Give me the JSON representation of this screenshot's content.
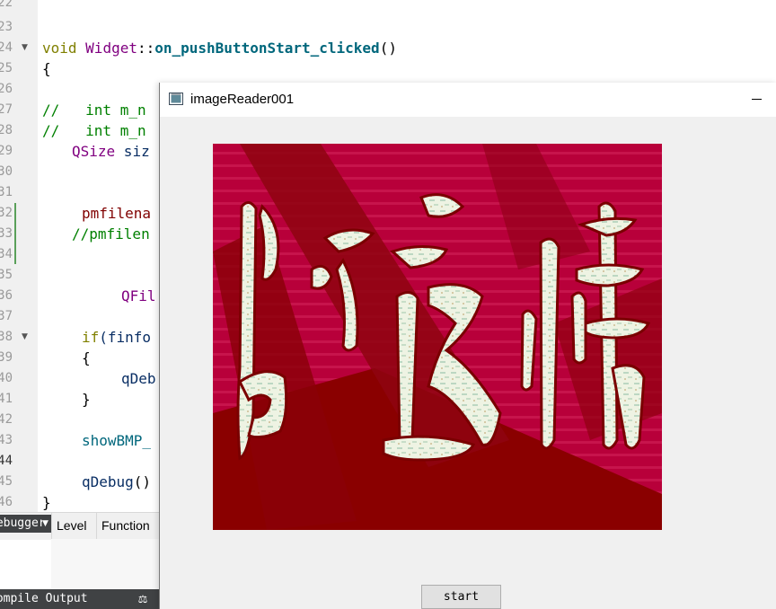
{
  "editor": {
    "line_numbers": [
      "22",
      "23",
      "24",
      "25",
      "26",
      "27",
      "28",
      "29",
      "30",
      "31",
      "32",
      "33",
      "34",
      "35",
      "36",
      "37",
      "38",
      "39",
      "40",
      "41",
      "42",
      "43",
      "44",
      "45",
      "46"
    ],
    "lines": {
      "l24_kw": "void",
      "l24_class": "Widget",
      "l24_sep": "::",
      "l24_fn": "on_pushButtonStart_clicked",
      "l24_paren": "()",
      "l25": "{",
      "l27_comment": "//   int m_n",
      "l28_comment": "//   int m_n",
      "l29_type": "QSize",
      "l29_rest": " siz",
      "l32": "pmfilena",
      "l33_comment": "//pmfilen",
      "l36": "QFil",
      "l38_kw": "if",
      "l38_rest": "(finfo",
      "l39": "{",
      "l40": "qDeb",
      "l41": "}",
      "l43": "showBMP_",
      "l45_fn": "qDebug",
      "l45_rest": "()",
      "l46": "}"
    }
  },
  "output_pane": {
    "debugger_combo": "Debugger",
    "columns": [
      "Level",
      "Function"
    ],
    "status_tab": "Compile Output"
  },
  "window": {
    "title": "imageReader001",
    "start_button": "start",
    "image_alt": "红色背景上的白色毛笔字（上方图片内容）"
  },
  "colors": {
    "image_bg": "#b8003a",
    "brush_stroke": "#e9f0de",
    "shadow_red": "#8a0000"
  }
}
